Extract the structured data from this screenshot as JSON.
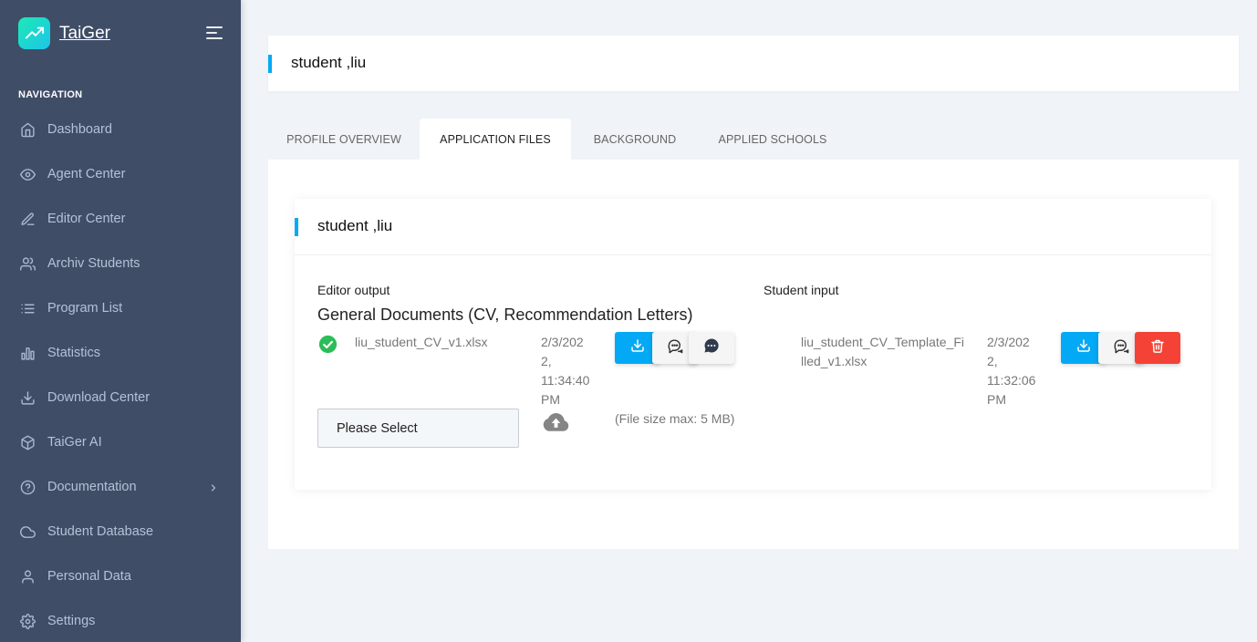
{
  "app": {
    "name": "TaiGer",
    "brand_color": "#1dc4e9"
  },
  "sidebar": {
    "caption": "NAVIGATION",
    "items": [
      {
        "label": "Dashboard",
        "icon": "home-icon"
      },
      {
        "label": "Agent Center",
        "icon": "eye-icon"
      },
      {
        "label": "Editor Center",
        "icon": "edit-icon"
      },
      {
        "label": "Archiv Students",
        "icon": "users-icon"
      },
      {
        "label": "Program List",
        "icon": "list-icon"
      },
      {
        "label": "Statistics",
        "icon": "bar-chart-icon"
      },
      {
        "label": "Download Center",
        "icon": "download-icon"
      },
      {
        "label": "TaiGer AI",
        "icon": "box-icon"
      },
      {
        "label": "Documentation",
        "icon": "help-circle-icon",
        "has_children": true
      },
      {
        "label": "Student Database",
        "icon": "cloud-icon"
      },
      {
        "label": "Personal Data",
        "icon": "user-icon"
      },
      {
        "label": "Settings",
        "icon": "settings-icon"
      }
    ]
  },
  "page": {
    "title": "student ,liu"
  },
  "tabs": [
    {
      "label": "PROFILE OVERVIEW",
      "active": false
    },
    {
      "label": "APPLICATION FILES",
      "active": true
    },
    {
      "label": "BACKGROUND",
      "active": false
    },
    {
      "label": "APPLIED SCHOOLS",
      "active": false
    }
  ],
  "card": {
    "title": "student ,liu",
    "editor_output": {
      "label": "Editor output",
      "section_title": "General Documents (CV, Recommendation Letters)",
      "file": {
        "status": "approved",
        "name": "liu_student_CV_v1.xlsx",
        "date_lines": [
          "2/3/202",
          "2,",
          "11:34:40",
          "PM"
        ]
      }
    },
    "student_input": {
      "label": "Student input",
      "file": {
        "name_lines": [
          "liu_student_CV_Template_Fi",
          "lled_v1.xlsx"
        ],
        "date_lines": [
          "2/3/202",
          "2,",
          "11:32:06",
          "PM"
        ]
      }
    },
    "upload": {
      "select_label": "Please Select",
      "size_note": "(File size max: 5 MB)"
    }
  },
  "colors": {
    "accent": "#04a9f5",
    "danger": "#f44236",
    "success": "#2ed8b6"
  }
}
